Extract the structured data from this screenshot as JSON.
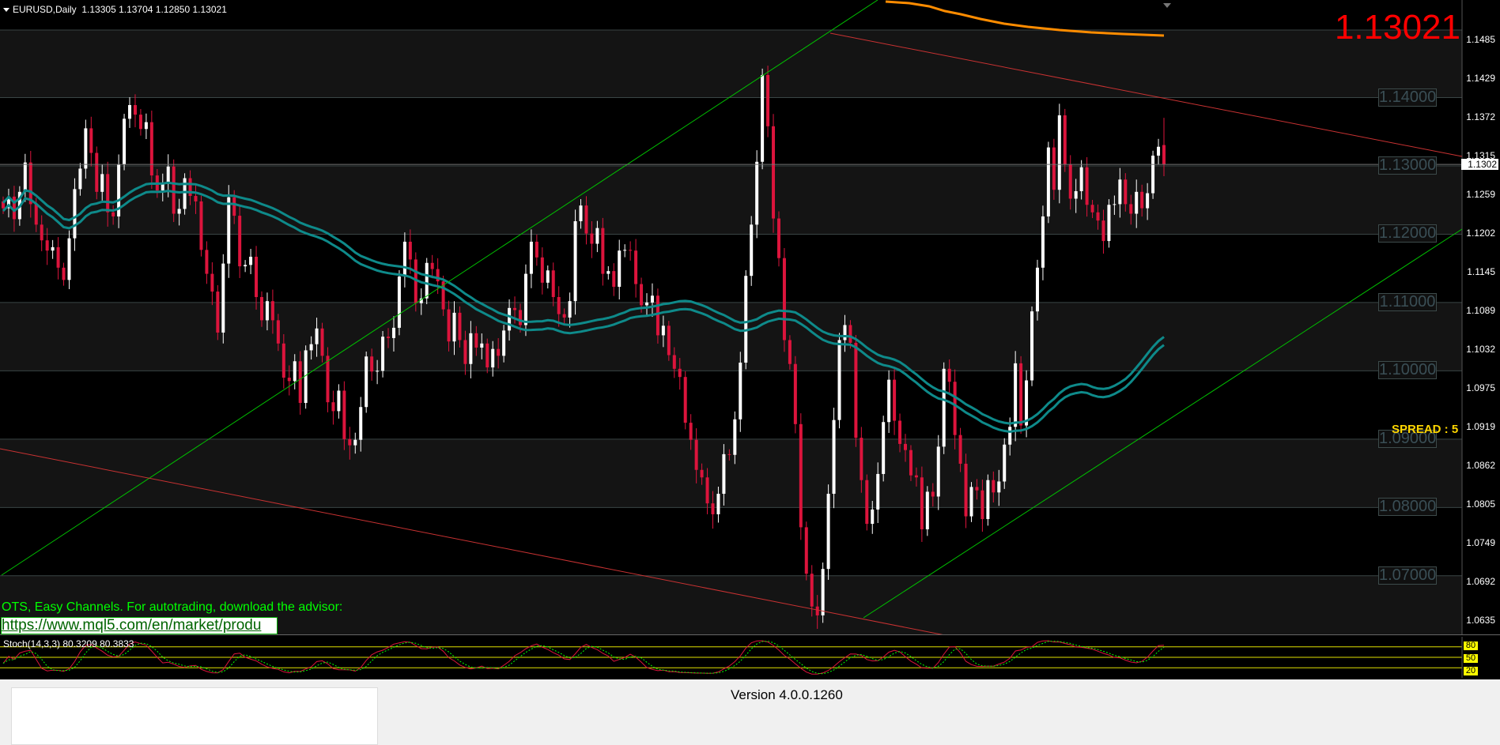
{
  "header": {
    "symbol": "EURUSD,Daily",
    "ohlc": "1.13305 1.13704 1.12850 1.13021"
  },
  "current_price_big": "1.13021",
  "current_price_axis": "1.1302",
  "price_axis": [
    "1.1485",
    "1.1429",
    "1.1372",
    "1.1315",
    "1.1259",
    "1.1202",
    "1.1145",
    "1.1089",
    "1.1032",
    "1.0975",
    "1.0919",
    "1.0862",
    "1.0805",
    "1.0749",
    "1.0692",
    "1.0635"
  ],
  "levels": [
    "1.14000",
    "1.13000",
    "1.12000",
    "1.11000",
    "1.10000",
    "1.09000",
    "1.08000",
    "1.07000"
  ],
  "spread": "SPREAD : 5",
  "ots_text": "OTS, Easy Channels. For autotrading, download the advisor:",
  "link_text": "https://www.mql5.com/en/market/produ",
  "stoch_label": "Stoch(14,3,3) 80.3209 80.3833",
  "stoch_levels": [
    "80",
    "50",
    "20"
  ],
  "version": "Version 4.0.0.1260",
  "colors": {
    "bull": "#ffffff",
    "bear": "#dc143c",
    "ma": "#0e8a8a",
    "orange": "#ff8c00",
    "green_line": "#00c000",
    "red_line": "#c83232",
    "stoch_main": "#dc143c",
    "stoch_signal": "#00ff00"
  },
  "chart_data": {
    "type": "candlestick",
    "symbol": "EURUSD",
    "timeframe": "Daily",
    "last": {
      "open": 1.13305,
      "high": 1.13704,
      "low": 1.1285,
      "close": 1.13021
    },
    "ylim": [
      1.0635,
      1.1485
    ],
    "horizontal_levels": [
      1.14,
      1.13,
      1.12,
      1.11,
      1.1,
      1.09,
      1.08,
      1.07
    ],
    "closes": [
      1.1238,
      1.1255,
      1.1222,
      1.1262,
      1.1305,
      1.1244,
      1.1214,
      1.1191,
      1.1176,
      1.1181,
      1.1151,
      1.1133,
      1.1194,
      1.1266,
      1.1296,
      1.1355,
      1.1319,
      1.1262,
      1.1288,
      1.1232,
      1.1226,
      1.1302,
      1.1369,
      1.1389,
      1.1375,
      1.1354,
      1.1364,
      1.1286,
      1.1264,
      1.1275,
      1.1299,
      1.123,
      1.1237,
      1.1282,
      1.1256,
      1.1248,
      1.1177,
      1.1142,
      1.1116,
      1.1056,
      1.1157,
      1.1254,
      1.1227,
      1.1153,
      1.1155,
      1.1167,
      1.1108,
      1.1074,
      1.1102,
      1.1074,
      1.104,
      1.099,
      1.0985,
      1.1014,
      1.0953,
      1.103,
      1.1039,
      1.1062,
      1.1022,
      1.0954,
      1.0941,
      1.0971,
      1.09,
      1.0891,
      1.0899,
      1.0947,
      1.1021,
      1.0999,
      1.1,
      1.105,
      1.1048,
      1.1063,
      1.1138,
      1.1189,
      1.1163,
      1.1099,
      1.1106,
      1.1158,
      1.1149,
      1.1131,
      1.109,
      1.1043,
      1.1085,
      1.1045,
      1.101,
      1.1055,
      1.1034,
      1.104,
      1.1005,
      1.1032,
      1.1022,
      1.1059,
      1.1092,
      1.1089,
      1.1067,
      1.1142,
      1.1189,
      1.1166,
      1.1129,
      1.1147,
      1.1108,
      1.1083,
      1.1078,
      1.1102,
      1.1219,
      1.1242,
      1.1201,
      1.1186,
      1.1209,
      1.1142,
      1.1146,
      1.1123,
      1.1176,
      1.1177,
      1.1176,
      1.1127,
      1.1096,
      1.11,
      1.111,
      1.1052,
      1.1066,
      1.1023,
      1.1003,
      1.0991,
      1.0924,
      1.0899,
      1.0855,
      1.0844,
      1.0806,
      1.079,
      1.082,
      1.0878,
      1.0877,
      1.0929,
      1.1012,
      1.1139,
      1.1214,
      1.1306,
      1.1433,
      1.1358,
      1.1223,
      1.1165,
      1.1045,
      1.101,
      1.0922,
      1.0771,
      1.0703,
      1.0655,
      1.0642,
      1.071,
      1.082,
      1.0928,
      1.1045,
      1.1067,
      1.1041,
      1.0902,
      1.084,
      1.0776,
      1.0797,
      1.0849,
      1.0925,
      1.0987,
      1.0927,
      1.0893,
      1.0884,
      1.0847,
      1.0844,
      1.0768,
      1.0823,
      1.0816,
      1.0889,
      1.1003,
      1.0984,
      1.0906,
      1.0864,
      1.0787,
      1.083,
      1.0825,
      1.0783,
      1.084,
      1.0822,
      1.0838,
      1.0892,
      1.0918,
      1.1011,
      1.092,
      1.0986,
      1.1087,
      1.1151,
      1.1226,
      1.1327,
      1.1265,
      1.1374,
      1.1302,
      1.1252,
      1.1263,
      1.1298,
      1.1243,
      1.1232,
      1.122,
      1.119,
      1.1243,
      1.1244,
      1.128,
      1.1244,
      1.123,
      1.1262,
      1.1238,
      1.126,
      1.1315,
      1.1328,
      1.1302
    ]
  }
}
